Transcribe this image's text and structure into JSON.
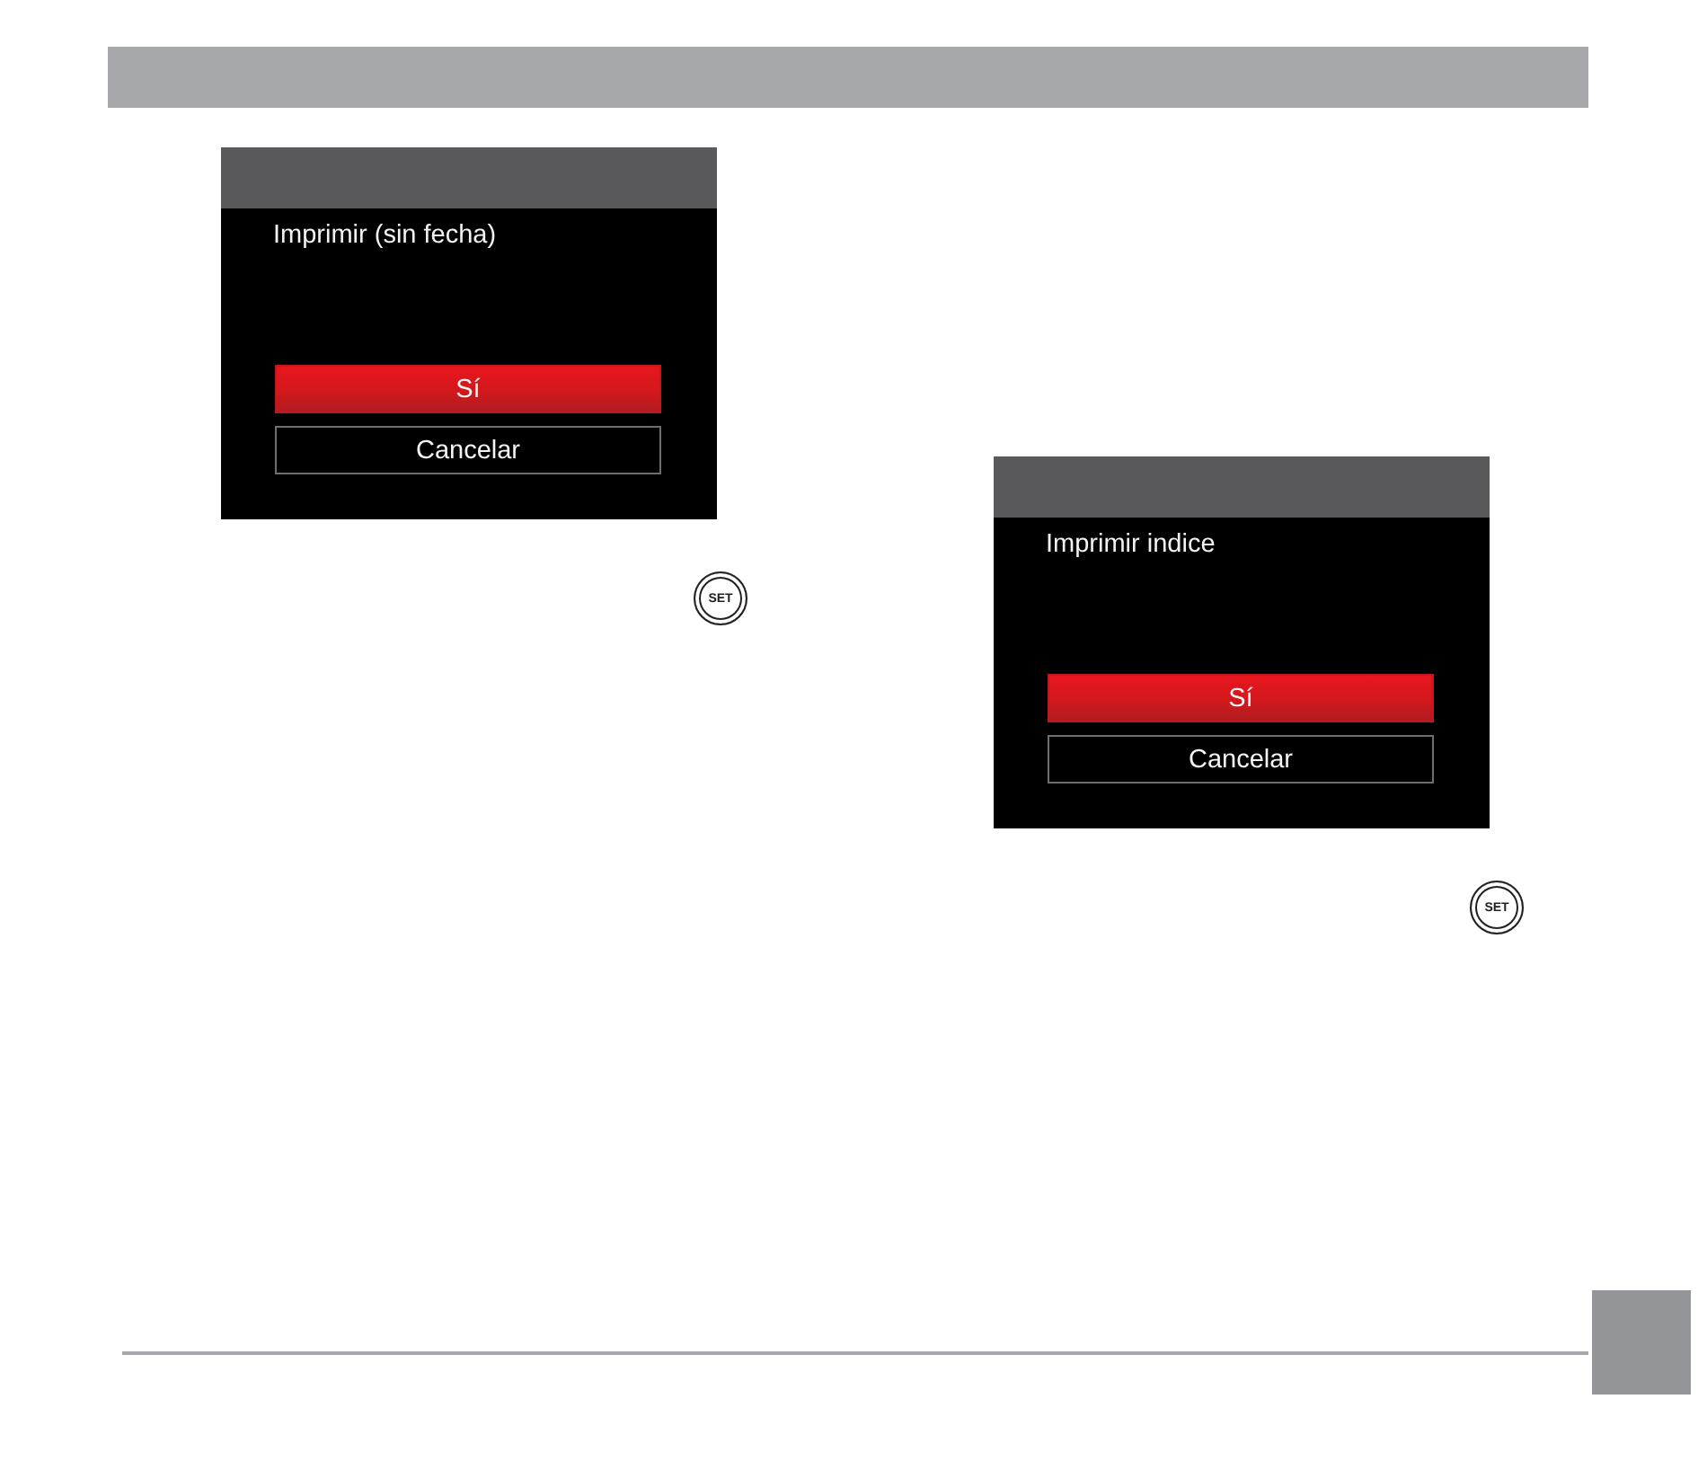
{
  "header_bar": {
    "shown": true
  },
  "dialogs": [
    {
      "message": "Imprimir (sin fecha)",
      "buttons": [
        {
          "label": "Sí",
          "selected": true
        },
        {
          "label": "Cancelar",
          "selected": false
        }
      ],
      "set_key": "SET"
    },
    {
      "message": "Imprimir indice",
      "buttons": [
        {
          "label": "Sí",
          "selected": true
        },
        {
          "label": "Cancelar",
          "selected": false
        }
      ],
      "set_key": "SET"
    }
  ],
  "page_tab": {
    "shown": true
  }
}
